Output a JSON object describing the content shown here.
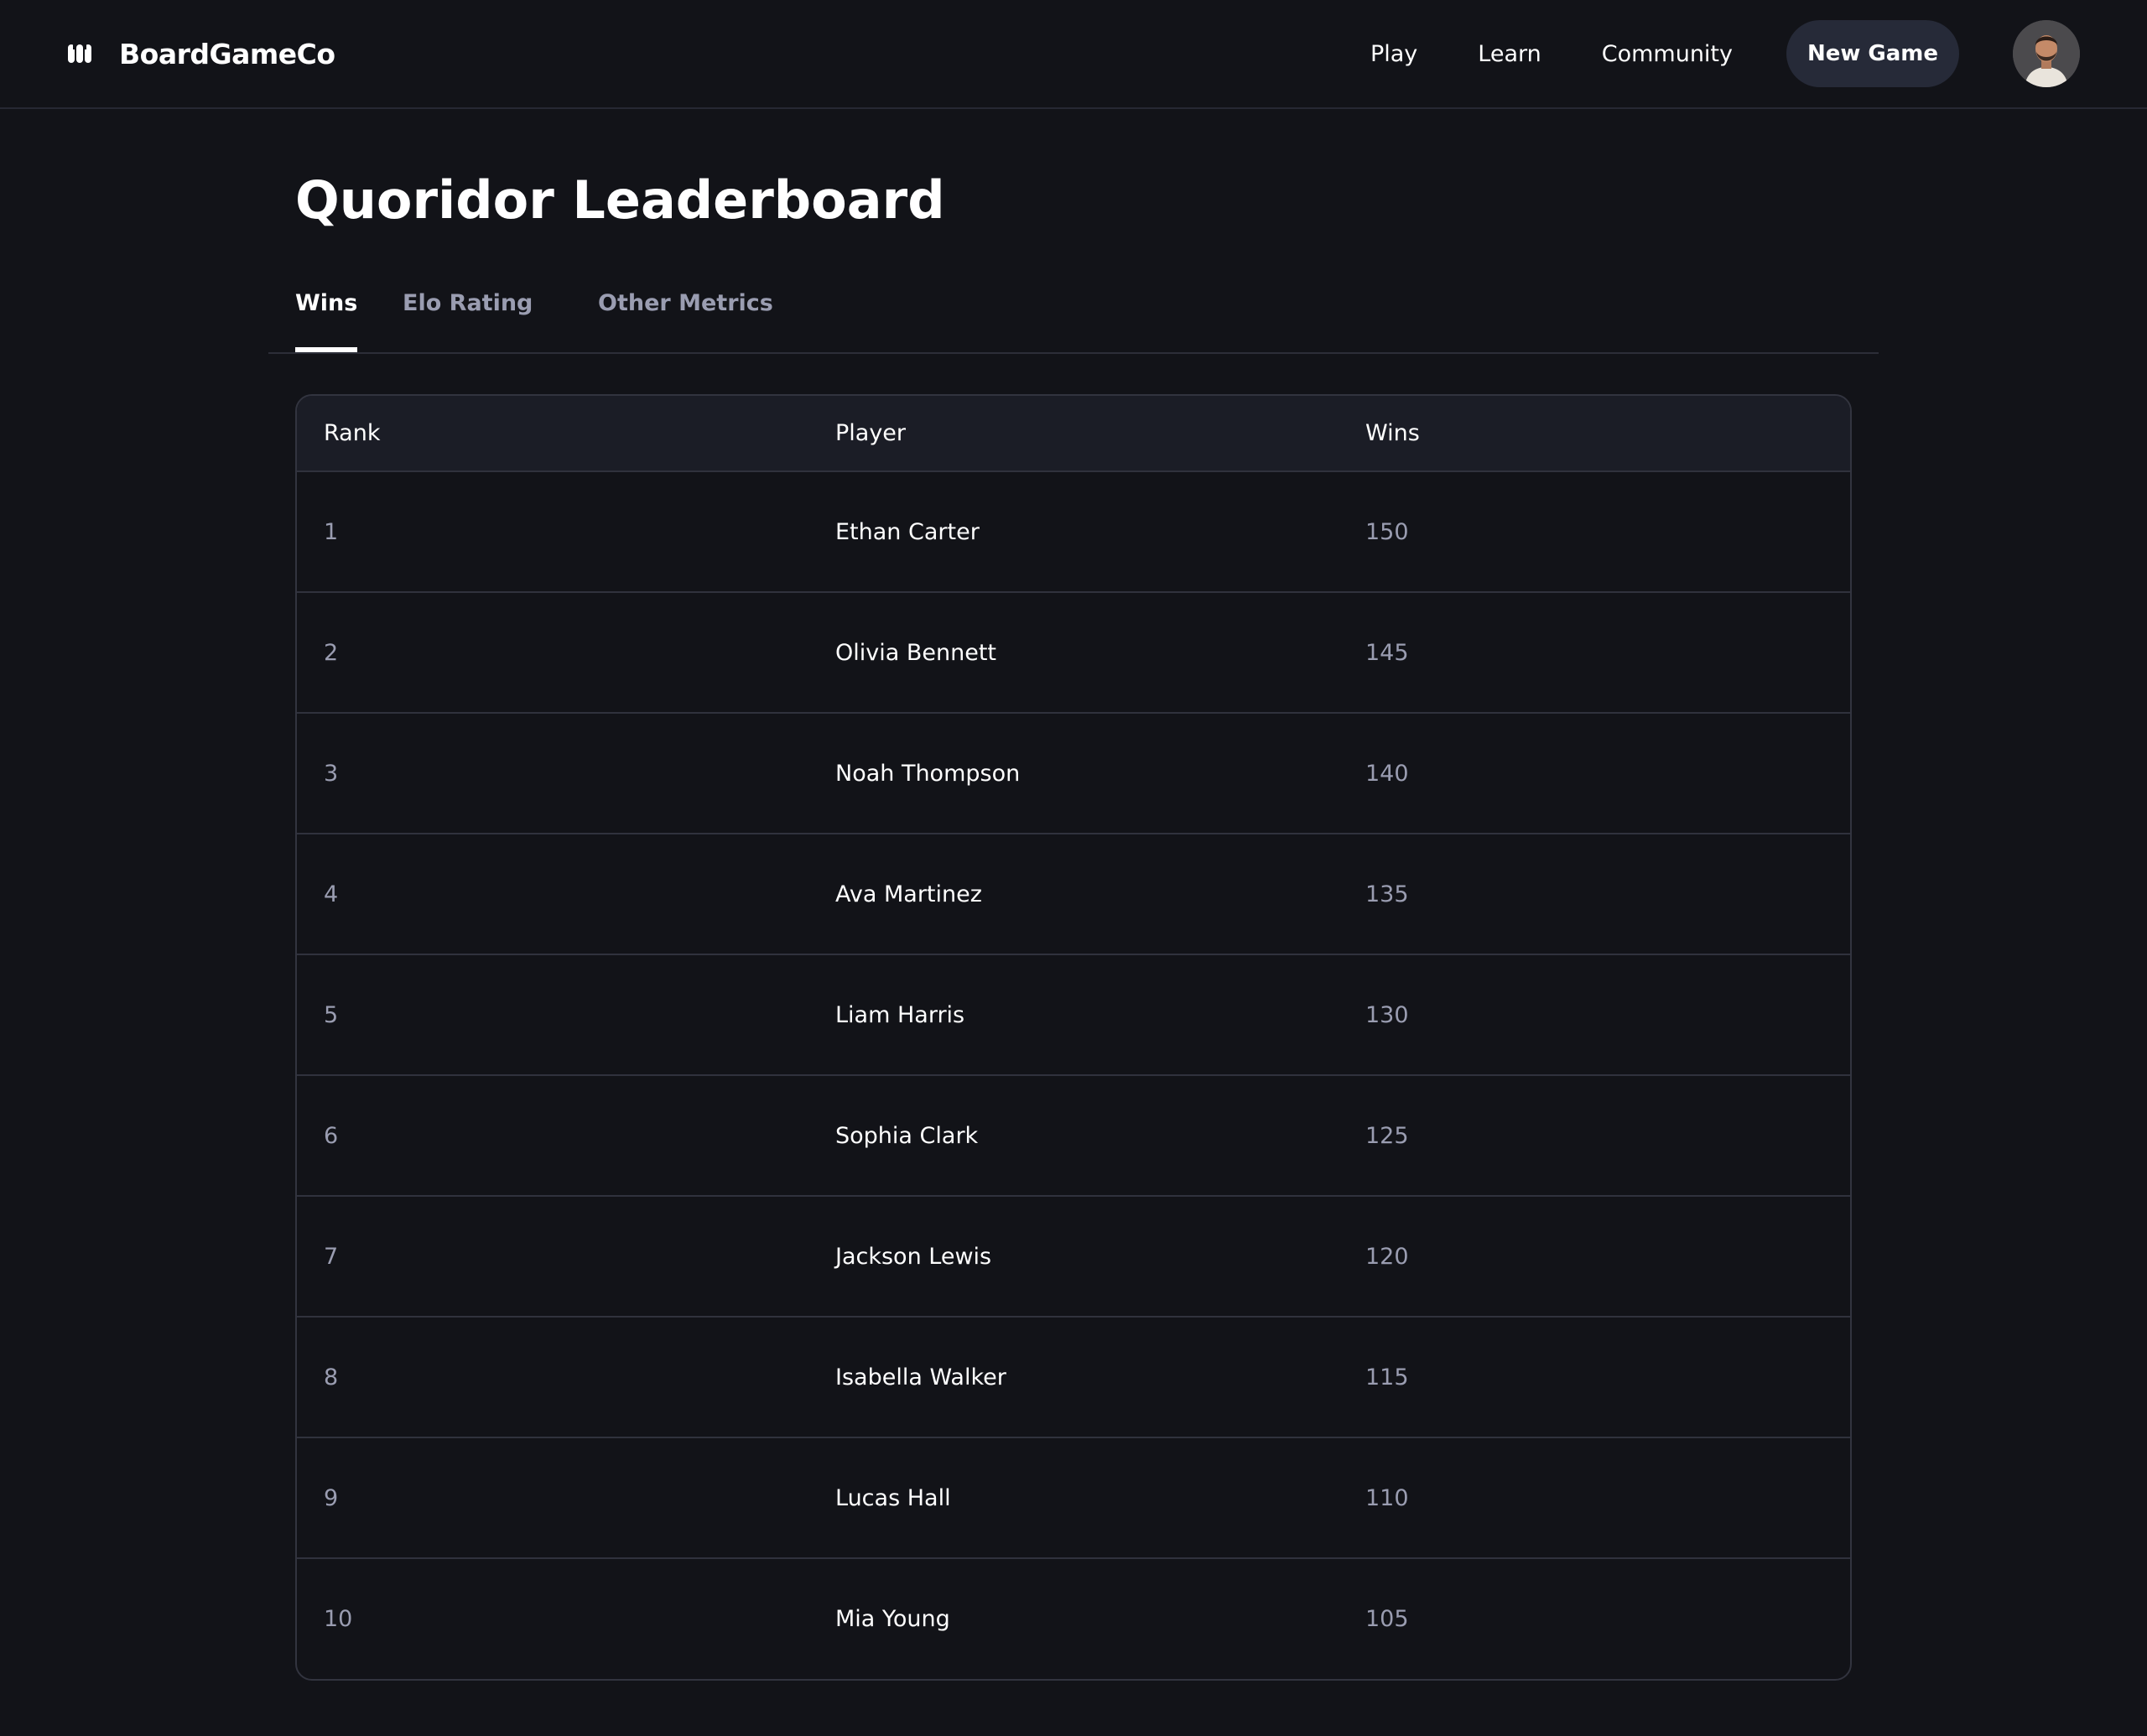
{
  "app": {
    "brand_name": "BoardGameCo"
  },
  "nav": {
    "items": [
      {
        "label": "Play"
      },
      {
        "label": "Learn"
      },
      {
        "label": "Community"
      }
    ],
    "new_game_label": "New Game"
  },
  "page": {
    "title": "Quoridor Leaderboard"
  },
  "tabs": [
    {
      "label": "Wins",
      "active": true
    },
    {
      "label": "Elo Rating",
      "active": false
    },
    {
      "label": "Other Metrics",
      "active": false
    }
  ],
  "table": {
    "columns": [
      "Rank",
      "Player",
      "Wins"
    ],
    "rows": [
      {
        "rank": "1",
        "player": "Ethan Carter",
        "wins": "150"
      },
      {
        "rank": "2",
        "player": "Olivia Bennett",
        "wins": "145"
      },
      {
        "rank": "3",
        "player": "Noah Thompson",
        "wins": "140"
      },
      {
        "rank": "4",
        "player": "Ava Martinez",
        "wins": "135"
      },
      {
        "rank": "5",
        "player": "Liam Harris",
        "wins": "130"
      },
      {
        "rank": "6",
        "player": "Sophia Clark",
        "wins": "125"
      },
      {
        "rank": "7",
        "player": "Jackson Lewis",
        "wins": "120"
      },
      {
        "rank": "8",
        "player": "Isabella Walker",
        "wins": "115"
      },
      {
        "rank": "9",
        "player": "Lucas Hall",
        "wins": "110"
      },
      {
        "rank": "10",
        "player": "Mia Young",
        "wins": "105"
      }
    ]
  },
  "colors": {
    "background": "#121318",
    "header_row": "#1b1d26",
    "button_bg": "#262a38",
    "muted_text": "#9a9db1",
    "border": "#30323d"
  },
  "icons": {
    "logo": "brand-logo-icon",
    "avatar": "user-avatar"
  }
}
